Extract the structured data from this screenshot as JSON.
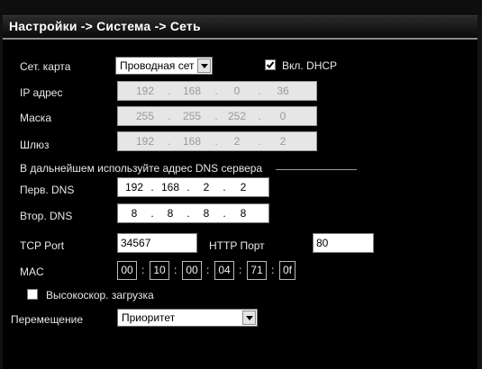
{
  "window": {
    "title": "Настройки -> Система -> Сеть"
  },
  "form": {
    "net_card": {
      "label": "Сет. карта",
      "value": "Проводная сет"
    },
    "dhcp": {
      "label": "Вкл. DHCP",
      "checked": true
    },
    "ip": {
      "label": "IP адрес",
      "octets": [
        "192",
        "168",
        "0",
        "36"
      ]
    },
    "mask": {
      "label": "Маска",
      "octets": [
        "255",
        "255",
        "252",
        "0"
      ]
    },
    "gateway": {
      "label": "Шлюз",
      "octets": [
        "192",
        "168",
        "2",
        "2"
      ]
    },
    "dns_note": "В дальнейшем используйте адрес DNS сервера",
    "dns1": {
      "label": "Перв. DNS",
      "octets": [
        "192",
        "168",
        "2",
        "2"
      ]
    },
    "dns2": {
      "label": "Втор. DNS",
      "octets": [
        "8",
        "8",
        "8",
        "8"
      ]
    },
    "tcp_port": {
      "label": "TCP Port",
      "value": "34567"
    },
    "http_port": {
      "label": "HTTP Порт",
      "value": "80"
    },
    "mac": {
      "label": "MAC",
      "parts": [
        "00",
        "10",
        "00",
        "04",
        "71",
        "0f"
      ]
    },
    "hs_download": {
      "label": "Высокоскор. загрузка",
      "checked": false
    },
    "transfer": {
      "label": "Перемещение",
      "value": "Приоритет"
    }
  }
}
